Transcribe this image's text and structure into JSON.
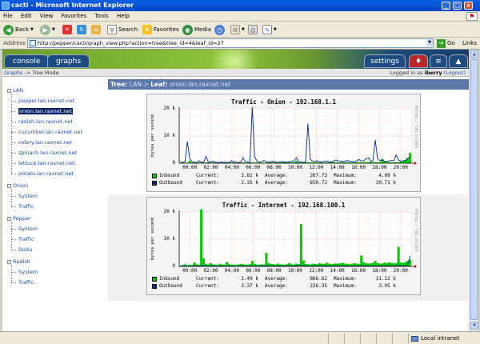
{
  "window": {
    "title": "cacti - Microsoft Internet Explorer"
  },
  "menu": [
    "File",
    "Edit",
    "View",
    "Favorites",
    "Tools",
    "Help"
  ],
  "toolbar": {
    "back": "Back",
    "search": "Search",
    "favorites": "Favorites",
    "media": "Media"
  },
  "address": {
    "label": "Address",
    "url": "http://pepper/cacti/graph_view.php?action=tree&tree_id=4&leaf_id=27",
    "go": "Go",
    "links": "Links"
  },
  "tabs": {
    "console": "console",
    "graphs": "graphs",
    "settings": "settings"
  },
  "nav": {
    "breadcrumb_link": "Graphs",
    "breadcrumb_sep": " -> ",
    "breadcrumb_current": "Tree Mode",
    "logged_in_as": "Logged in as ",
    "user": "iberry",
    "logout": "(Logout)"
  },
  "treebar": {
    "prefix": "Tree: ",
    "tree": "LAN",
    "arrow": "-> ",
    "leaf_label": "Leaf: ",
    "leaf": "onion.lan.raxnet.net"
  },
  "tree": [
    {
      "label": "LAN",
      "depth": 0
    },
    {
      "label": "pepper.lan.raxnet.net",
      "depth": 1
    },
    {
      "label": "onion.lan.raxnet.net",
      "depth": 1,
      "selected": true
    },
    {
      "label": "radish.lan.raxnet.net",
      "depth": 1
    },
    {
      "label": "cucumber.lan.raxnet.net",
      "depth": 1
    },
    {
      "label": "celery.lan.raxnet.net",
      "depth": 1
    },
    {
      "label": "spinach.lan.raxnet.net",
      "depth": 1
    },
    {
      "label": "lettuce.lan.raxnet.net",
      "depth": 1
    },
    {
      "label": "potato.lan.raxnet.net",
      "depth": 1
    },
    {
      "label": "Onion",
      "depth": 0
    },
    {
      "label": "System",
      "depth": 1
    },
    {
      "label": "Traffic",
      "depth": 1
    },
    {
      "label": "Pepper",
      "depth": 0
    },
    {
      "label": "System",
      "depth": 1
    },
    {
      "label": "Traffic",
      "depth": 1
    },
    {
      "label": "Disks",
      "depth": 1
    },
    {
      "label": "Radish",
      "depth": 0
    },
    {
      "label": "System",
      "depth": 1
    },
    {
      "label": "Traffic",
      "depth": 1
    }
  ],
  "colors": {
    "inbound": "#00cc00",
    "outbound": "#002a97"
  },
  "status": {
    "zone": "Local intranet"
  },
  "chart_data": [
    {
      "type": "area",
      "title": "Traffic - Onion - 192.168.1.1",
      "ylabel": "bytes per second",
      "ylim": [
        0,
        20000
      ],
      "yticks": [
        "0",
        "10 k",
        "20 k"
      ],
      "xticks": [
        "00:00",
        "02:00",
        "04:00",
        "06:00",
        "08:00",
        "10:00",
        "12:00",
        "14:00",
        "16:00",
        "18:00",
        "20:00"
      ],
      "vertical_text": "RRDTOOL / TOBI OETIKER",
      "series": [
        {
          "name": "Inbound",
          "color": "#00cc00",
          "current": "3.81 k",
          "average": "267.73",
          "maximum": "4.09 k",
          "values": [
            150,
            120,
            200,
            180,
            900,
            220,
            150,
            180,
            260,
            200,
            160,
            220,
            300,
            180,
            240,
            200,
            150,
            190,
            220,
            260,
            180,
            200,
            300,
            220,
            180,
            150,
            240,
            260,
            200,
            220,
            280,
            260,
            240,
            300,
            220,
            200,
            180,
            250,
            260,
            300,
            320,
            380,
            260,
            300,
            280,
            340,
            360,
            300,
            320,
            400,
            900,
            300,
            260,
            280,
            320,
            360,
            300,
            260,
            280,
            340,
            300,
            320,
            260,
            280,
            300,
            360,
            420,
            300,
            280,
            320,
            360,
            340,
            400,
            300,
            260,
            280,
            320,
            380,
            300,
            360,
            400,
            420,
            600,
            300,
            320,
            360,
            400,
            1600,
            700,
            450,
            380,
            300,
            320,
            360,
            400,
            500,
            700,
            1200,
            1800,
            3800
          ]
        },
        {
          "name": "Outbound",
          "color": "#002a97",
          "current": "2.35 k",
          "average": "650.72",
          "maximum": "20.71 k",
          "values": [
            400,
            300,
            500,
            8000,
            1800,
            600,
            300,
            250,
            900,
            400,
            300,
            2500,
            600,
            400,
            800,
            300,
            200,
            350,
            400,
            300,
            250,
            300,
            900,
            500,
            300,
            250,
            300,
            2000,
            600,
            400,
            300,
            20710,
            2500,
            800,
            400,
            500,
            1000,
            600,
            400,
            500,
            800,
            400,
            300,
            500,
            600,
            400,
            350,
            500,
            700,
            900,
            2000,
            600,
            400,
            300,
            500,
            14600,
            1500,
            800,
            600,
            900,
            500,
            400,
            700,
            800,
            600,
            400,
            700,
            1200,
            900,
            700,
            600,
            800,
            1000,
            700,
            600,
            500,
            800,
            1400,
            800,
            900,
            1600,
            2000,
            900,
            700,
            8600,
            1800,
            900,
            1200,
            700,
            600,
            800,
            1000,
            900,
            3000,
            1200,
            700,
            900,
            1000,
            1800,
            2350
          ]
        }
      ]
    },
    {
      "type": "area",
      "title": "Traffic - Internet - 192.168.100.1",
      "ylabel": "bytes per second",
      "ylim": [
        0,
        20000
      ],
      "yticks": [
        "0",
        "10 k",
        "20 k"
      ],
      "xticks": [
        "00:00",
        "02:00",
        "04:00",
        "06:00",
        "08:00",
        "10:00",
        "12:00",
        "14:00",
        "16:00",
        "18:00",
        "20:00"
      ],
      "vertical_text": "RRDTOOL / TOBI OETIKER",
      "series": [
        {
          "name": "Inbound",
          "color": "#00cc00",
          "current": "2.49 k",
          "average": "866.62",
          "maximum": "21.12 k",
          "values": [
            300,
            500,
            800,
            400,
            600,
            500,
            1400,
            800,
            600,
            21120,
            3000,
            900,
            700,
            1200,
            800,
            600,
            500,
            900,
            700,
            600,
            1600,
            800,
            700,
            600,
            500,
            700,
            900,
            800,
            700,
            600,
            800,
            2000,
            900,
            700,
            600,
            800,
            700,
            5000,
            1200,
            900,
            800,
            700,
            1000,
            800,
            700,
            600,
            900,
            1200,
            800,
            700,
            1000,
            900,
            15600,
            2200,
            900,
            800,
            700,
            1000,
            900,
            800,
            1200,
            1000,
            900,
            1400,
            1000,
            800,
            900,
            1100,
            1000,
            1200,
            1300,
            1000,
            900,
            800,
            1000,
            1200,
            1000,
            900,
            4000,
            1500,
            1200,
            1000,
            1100,
            1300,
            2000,
            1200,
            1000,
            1100,
            1400,
            1200,
            1500,
            1300,
            1100,
            1200,
            7200,
            1500,
            1300,
            1600,
            2000,
            2490
          ]
        },
        {
          "name": "Outbound",
          "color": "#002a97",
          "current": "3.37 k",
          "average": "226.35",
          "maximum": "3.95 k",
          "values": [
            100,
            120,
            150,
            100,
            130,
            120,
            200,
            150,
            130,
            400,
            200,
            150,
            130,
            160,
            150,
            120,
            110,
            150,
            130,
            120,
            200,
            150,
            130,
            120,
            110,
            130,
            150,
            140,
            130,
            120,
            140,
            250,
            150,
            130,
            120,
            150,
            130,
            300,
            180,
            150,
            140,
            130,
            170,
            150,
            140,
            130,
            150,
            200,
            150,
            140,
            170,
            150,
            500,
            250,
            150,
            140,
            130,
            170,
            150,
            140,
            200,
            170,
            150,
            220,
            170,
            140,
            150,
            180,
            170,
            200,
            210,
            170,
            150,
            140,
            170,
            200,
            170,
            150,
            350,
            220,
            200,
            170,
            180,
            210,
            300,
            200,
            170,
            180,
            220,
            200,
            240,
            210,
            180,
            200,
            600,
            240,
            210,
            260,
            320,
            3950
          ]
        }
      ]
    }
  ]
}
